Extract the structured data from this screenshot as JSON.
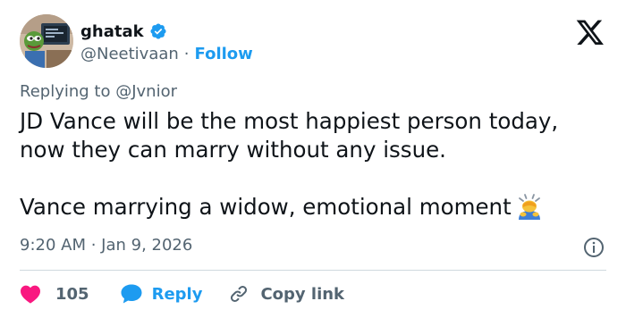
{
  "author": {
    "display_name": "ghatak",
    "handle": "@Neetivaan",
    "separator": "·",
    "follow_label": "Follow",
    "verified_icon": "verified-badge-icon",
    "avatar": "avatar-image"
  },
  "brand": {
    "logo": "x-logo-icon"
  },
  "reply_context": "Replying to @Jvnior",
  "tweet": {
    "lines": [
      "JD Vance will be the most happiest person today,",
      "now they can marry without any issue.",
      "Vance marrying a widow, emotional moment"
    ],
    "emoji": "man-bowing-emoji"
  },
  "meta": {
    "timestamp": "9:20 AM · Jan 9, 2026",
    "info_icon": "info-icon"
  },
  "actions": {
    "like_count": "105",
    "reply_label": "Reply",
    "copy_link_label": "Copy link"
  },
  "colors": {
    "accent": "#1d9bf0",
    "like": "#f91880",
    "text": "#0f1419",
    "secondary": "#536471",
    "divider": "#cfd9de"
  }
}
